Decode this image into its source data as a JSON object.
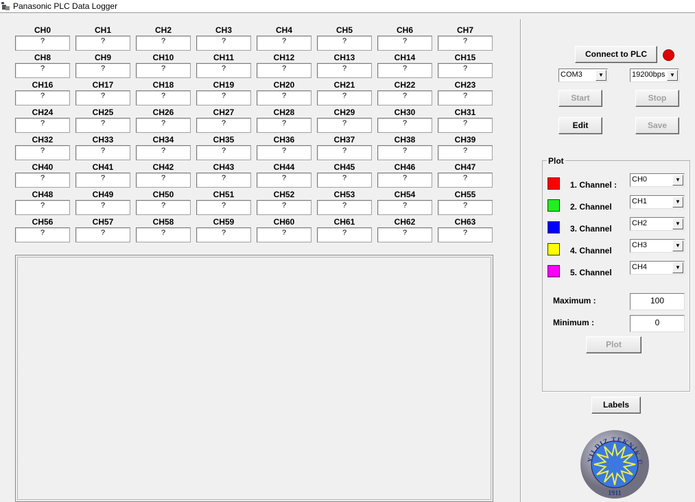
{
  "window": {
    "title": "Panasonic PLC Data Logger"
  },
  "channels": [
    {
      "label": "CH0",
      "value": "?"
    },
    {
      "label": "CH1",
      "value": "?"
    },
    {
      "label": "CH2",
      "value": "?"
    },
    {
      "label": "CH3",
      "value": "?"
    },
    {
      "label": "CH4",
      "value": "?"
    },
    {
      "label": "CH5",
      "value": "?"
    },
    {
      "label": "CH6",
      "value": "?"
    },
    {
      "label": "CH7",
      "value": "?"
    },
    {
      "label": "CH8",
      "value": "?"
    },
    {
      "label": "CH9",
      "value": "?"
    },
    {
      "label": "CH10",
      "value": "?"
    },
    {
      "label": "CH11",
      "value": "?"
    },
    {
      "label": "CH12",
      "value": "?"
    },
    {
      "label": "CH13",
      "value": "?"
    },
    {
      "label": "CH14",
      "value": "?"
    },
    {
      "label": "CH15",
      "value": "?"
    },
    {
      "label": "CH16",
      "value": "?"
    },
    {
      "label": "CH17",
      "value": "?"
    },
    {
      "label": "CH18",
      "value": "?"
    },
    {
      "label": "CH19",
      "value": "?"
    },
    {
      "label": "CH20",
      "value": "?"
    },
    {
      "label": "CH21",
      "value": "?"
    },
    {
      "label": "CH22",
      "value": "?"
    },
    {
      "label": "CH23",
      "value": "?"
    },
    {
      "label": "CH24",
      "value": "?"
    },
    {
      "label": "CH25",
      "value": "?"
    },
    {
      "label": "CH26",
      "value": "?"
    },
    {
      "label": "CH27",
      "value": "?"
    },
    {
      "label": "CH28",
      "value": "?"
    },
    {
      "label": "CH29",
      "value": "?"
    },
    {
      "label": "CH30",
      "value": "?"
    },
    {
      "label": "CH31",
      "value": "?"
    },
    {
      "label": "CH32",
      "value": "?"
    },
    {
      "label": "CH33",
      "value": "?"
    },
    {
      "label": "CH34",
      "value": "?"
    },
    {
      "label": "CH35",
      "value": "?"
    },
    {
      "label": "CH36",
      "value": "?"
    },
    {
      "label": "CH37",
      "value": "?"
    },
    {
      "label": "CH38",
      "value": "?"
    },
    {
      "label": "CH39",
      "value": "?"
    },
    {
      "label": "CH40",
      "value": "?"
    },
    {
      "label": "CH41",
      "value": "?"
    },
    {
      "label": "CH42",
      "value": "?"
    },
    {
      "label": "CH43",
      "value": "?"
    },
    {
      "label": "CH44",
      "value": "?"
    },
    {
      "label": "CH45",
      "value": "?"
    },
    {
      "label": "CH46",
      "value": "?"
    },
    {
      "label": "CH47",
      "value": "?"
    },
    {
      "label": "CH48",
      "value": "?"
    },
    {
      "label": "CH49",
      "value": "?"
    },
    {
      "label": "CH50",
      "value": "?"
    },
    {
      "label": "CH51",
      "value": "?"
    },
    {
      "label": "CH52",
      "value": "?"
    },
    {
      "label": "CH53",
      "value": "?"
    },
    {
      "label": "CH54",
      "value": "?"
    },
    {
      "label": "CH55",
      "value": "?"
    },
    {
      "label": "CH56",
      "value": "?"
    },
    {
      "label": "CH57",
      "value": "?"
    },
    {
      "label": "CH58",
      "value": "?"
    },
    {
      "label": "CH59",
      "value": "?"
    },
    {
      "label": "CH60",
      "value": "?"
    },
    {
      "label": "CH61",
      "value": "?"
    },
    {
      "label": "CH62",
      "value": "?"
    },
    {
      "label": "CH63",
      "value": "?"
    }
  ],
  "controls": {
    "connect": "Connect to PLC",
    "status_color": "#e00000",
    "port": "COM3",
    "baud": "19200bps",
    "start": "Start",
    "stop": "Stop",
    "edit": "Edit",
    "save": "Save",
    "labels": "Labels"
  },
  "plot": {
    "title": "Plot",
    "channels": [
      {
        "label": "1. Channel :",
        "color": "#ff0000",
        "selected": "CH0"
      },
      {
        "label": "2. Channel",
        "color": "#22ee22",
        "selected": "CH1"
      },
      {
        "label": "3. Channel",
        "color": "#0000ff",
        "selected": "CH2"
      },
      {
        "label": "4. Channel",
        "color": "#ffff00",
        "selected": "CH3"
      },
      {
        "label": "5. Channel",
        "color": "#ff00ff",
        "selected": "CH4"
      }
    ],
    "max_label": "Maximum :",
    "max_value": "100",
    "min_label": "Minimum  :",
    "min_value": "0",
    "plot_button": "Plot"
  },
  "logo": {
    "text": "YILDIZ TEKNİK ÜNİVERSİTESİ",
    "year": "1911"
  }
}
